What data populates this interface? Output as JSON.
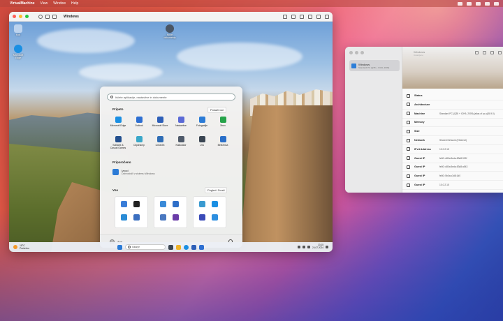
{
  "menubar": {
    "app": "VirtualMachine",
    "items": [
      "View",
      "Window",
      "Help"
    ]
  },
  "vm": {
    "title": "Windows",
    "desktop_icons": [
      {
        "label": "Koš"
      },
      {
        "label": "Microsoft Edge"
      },
      {
        "label": "Nové dokumenty"
      }
    ],
    "start": {
      "search_placeholder": "Iščete aplikacije, nastavitve in dokumente",
      "pinned_title": "Pripeto",
      "pinned_btn": "Pokaži vse",
      "pinned": [
        {
          "label": "Microsoft Edge",
          "color": "#1a8fe3"
        },
        {
          "label": "Outlook",
          "color": "#2d6fd2"
        },
        {
          "label": "Microsoft Store",
          "color": "#2d5fb8"
        },
        {
          "label": "Nastavitve",
          "color": "#5b6ad6"
        },
        {
          "label": "Fotografije",
          "color": "#2b7bd6"
        },
        {
          "label": "Xbox",
          "color": "#26a34a"
        },
        {
          "label": "Solitaire & Casual Games",
          "color": "#23508f"
        },
        {
          "label": "Clipchamp",
          "color": "#3aa7c9"
        },
        {
          "label": "LinkedIn",
          "color": "#2f6db5"
        },
        {
          "label": "Kalkulator",
          "color": "#4f5a6a"
        },
        {
          "label": "Ura",
          "color": "#3a4552"
        },
        {
          "label": "Beležnica",
          "color": "#2a6fc9"
        }
      ],
      "recommended_title": "Priporočeno",
      "recommended": {
        "title": "Izvod",
        "subtitle": "Dobrodošli v sistemu Windows"
      },
      "all_title": "Vse",
      "all_btn": "Pogled: Zvrsti",
      "folders": [
        [
          "#3a7dd8",
          "#222",
          "#2b8cd6",
          "#3b6fc0"
        ],
        [
          "#3a8ad8",
          "#2e6ec8",
          "#4a78c0",
          "#6a3ca8"
        ],
        [
          "#3a9ad0",
          "#1a8fe3",
          "#3a4bb8",
          "#2d8fe0"
        ]
      ],
      "user": "Ana"
    },
    "taskbar": {
      "weather_temp": "18°C",
      "weather_desc": "Pretežno",
      "search_text": "Iskanje",
      "time": "13:15",
      "date": "24.07.2024"
    }
  },
  "info": {
    "sidebar_item": {
      "title": "Windows",
      "subtitle": "Standard PC (Q35 + ICH9, 2009)"
    },
    "header_name": "Windows",
    "header_sub": "Ustavljeno",
    "rows": [
      {
        "key": "Status",
        "value": ""
      },
      {
        "key": "Architecture",
        "value": ""
      },
      {
        "key": "Machine",
        "value": "Standard PC (Q35 + ICH9, 2009) (alias of pc-q35-9.0)"
      },
      {
        "key": "Memory",
        "value": ""
      },
      {
        "key": "Size",
        "value": ""
      },
      {
        "key": "Network",
        "value": "Shared Network (Ethernet)"
      },
      {
        "key": "IPv4 Address",
        "value": "10.0.2.15"
      },
      {
        "key": "Guest IP",
        "value": "fe80::d80a:5eda:83d8:932f"
      },
      {
        "key": "Guest IP",
        "value": "fe80::d80a:5eda:83d8:a543"
      },
      {
        "key": "Guest IP",
        "value": "fe80::5b0a:c3d8:1d0"
      },
      {
        "key": "Guest IP",
        "value": "10.0.2.15"
      }
    ]
  }
}
